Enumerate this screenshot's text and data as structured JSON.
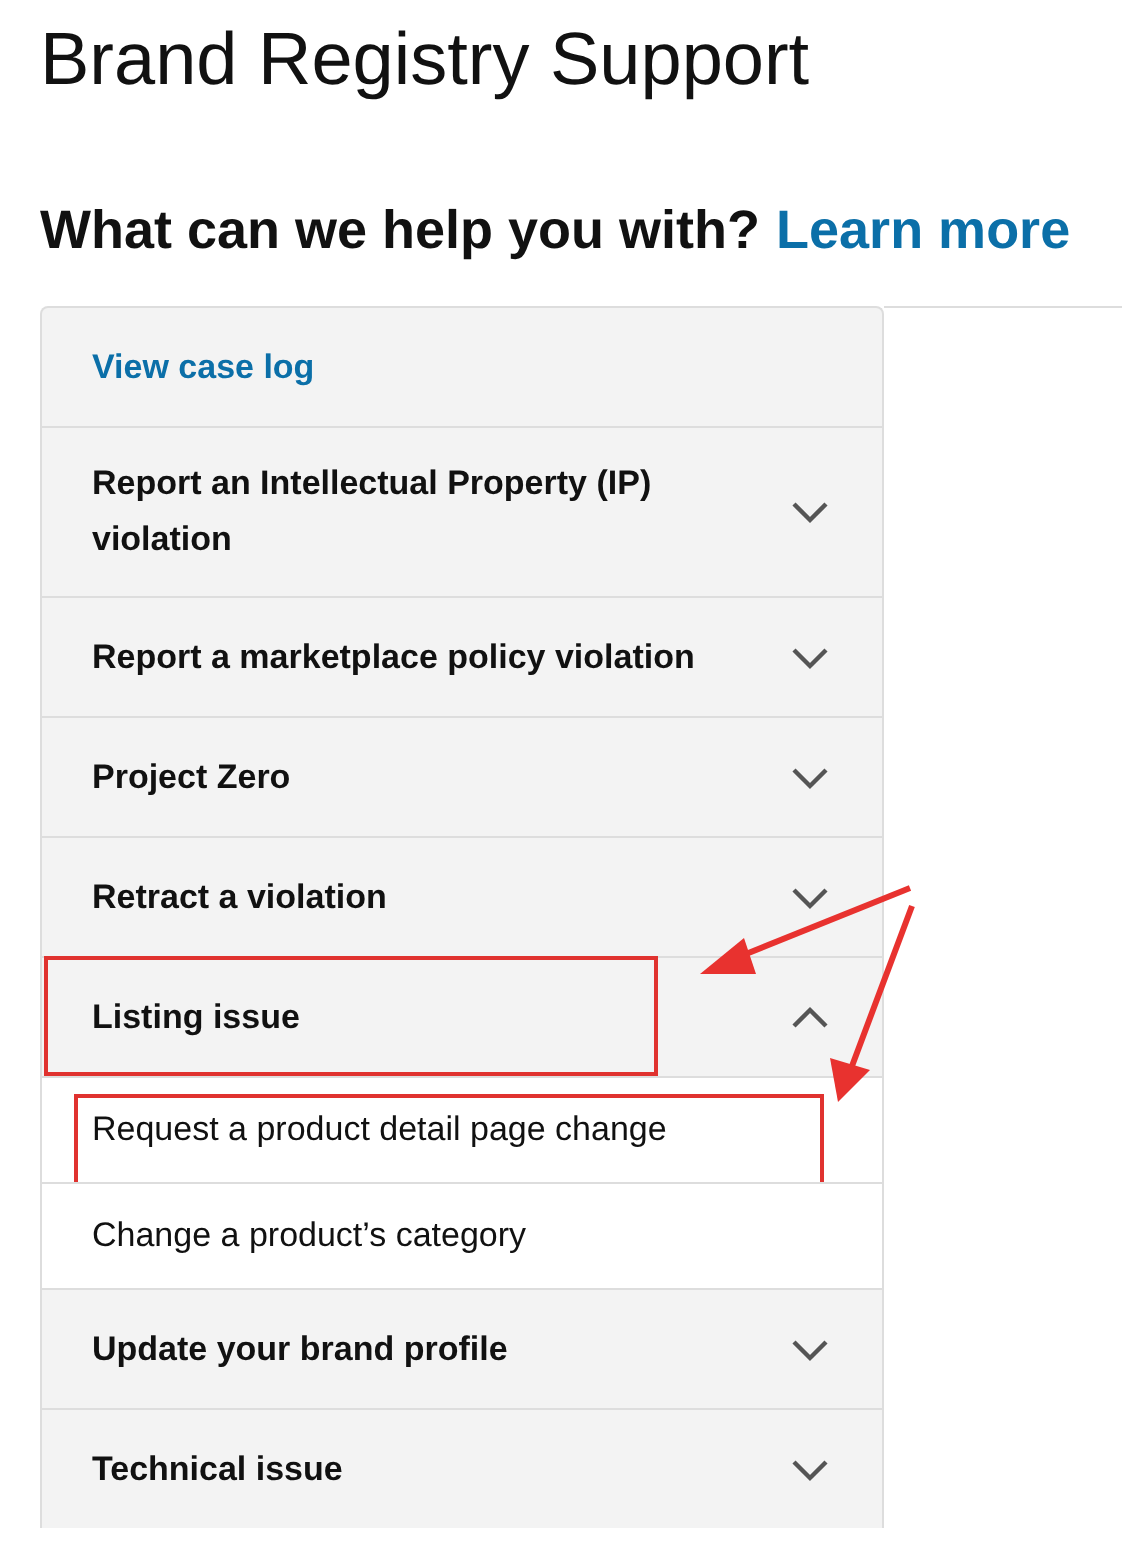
{
  "title": "Brand Registry Support",
  "heading": {
    "text": "What can we help you with?",
    "link": "Learn more"
  },
  "menu": [
    {
      "kind": "link",
      "label": "View case log"
    },
    {
      "kind": "section",
      "label": "Report an Intellectual Property (IP) violation",
      "expanded": false,
      "highlighted": false
    },
    {
      "kind": "section",
      "label": "Report a marketplace policy violation",
      "expanded": false,
      "highlighted": false
    },
    {
      "kind": "section",
      "label": "Project Zero",
      "expanded": false,
      "highlighted": false
    },
    {
      "kind": "section",
      "label": "Retract a violation",
      "expanded": false,
      "highlighted": false
    },
    {
      "kind": "section",
      "label": "Listing issue",
      "expanded": true,
      "highlighted": true,
      "children": [
        {
          "label": "Request a product detail page change",
          "highlighted": true
        },
        {
          "label": "Change a product’s category",
          "highlighted": false
        }
      ]
    },
    {
      "kind": "section",
      "label": "Update your brand profile",
      "expanded": false,
      "highlighted": false
    },
    {
      "kind": "section",
      "label": "Technical issue",
      "expanded": false,
      "highlighted": false
    }
  ]
}
